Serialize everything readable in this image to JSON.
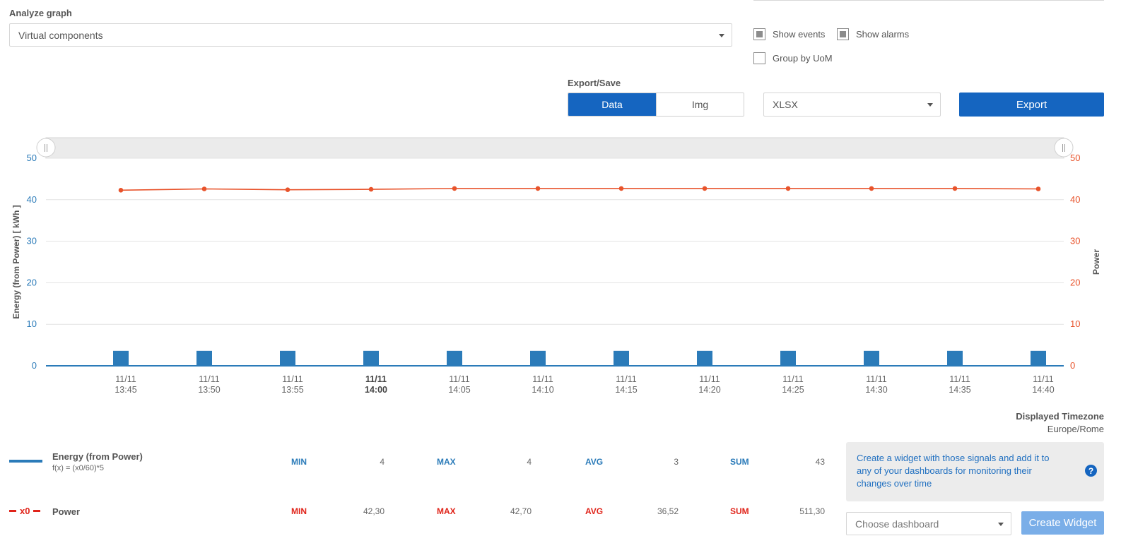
{
  "analyze": {
    "label": "Analyze graph",
    "selected": "Virtual components"
  },
  "options": {
    "show_events": {
      "label": "Show events",
      "checked": true
    },
    "show_alarms": {
      "label": "Show alarms",
      "checked": true
    },
    "group_uom": {
      "label": "Group by UoM",
      "checked": false
    }
  },
  "export": {
    "label": "Export/Save",
    "modes": [
      "Data",
      "Img"
    ],
    "active_mode": "Data",
    "format": "XLSX",
    "button": "Export"
  },
  "chart_data": {
    "type": "bar",
    "categories": [
      "11/11 13:45",
      "11/11 13:50",
      "11/11 13:55",
      "11/11 14:00",
      "11/11 14:05",
      "11/11 14:10",
      "11/11 14:15",
      "11/11 14:20",
      "11/11 14:25",
      "11/11 14:30",
      "11/11 14:35",
      "11/11 14:40"
    ],
    "tick_labels": [
      {
        "date": "11/11",
        "time": "13:45",
        "bold": false
      },
      {
        "date": "11/11",
        "time": "13:50",
        "bold": false
      },
      {
        "date": "11/11",
        "time": "13:55",
        "bold": false
      },
      {
        "date": "11/11",
        "time": "14:00",
        "bold": true
      },
      {
        "date": "11/11",
        "time": "14:05",
        "bold": false
      },
      {
        "date": "11/11",
        "time": "14:10",
        "bold": false
      },
      {
        "date": "11/11",
        "time": "14:15",
        "bold": false
      },
      {
        "date": "11/11",
        "time": "14:20",
        "bold": false
      },
      {
        "date": "11/11",
        "time": "14:25",
        "bold": false
      },
      {
        "date": "11/11",
        "time": "14:30",
        "bold": false
      },
      {
        "date": "11/11",
        "time": "14:35",
        "bold": false
      },
      {
        "date": "11/11",
        "time": "14:40",
        "bold": false
      }
    ],
    "series": [
      {
        "name": "Energy (from Power)",
        "kind": "bar",
        "axis": "left",
        "color": "#2b7bb9",
        "values": [
          3.6,
          3.6,
          3.6,
          3.6,
          3.6,
          3.6,
          3.6,
          3.6,
          3.6,
          3.6,
          3.6,
          3.6
        ]
      },
      {
        "name": "Power",
        "kind": "line",
        "axis": "right",
        "color": "#e8532b",
        "values": [
          42.3,
          42.6,
          42.4,
          42.5,
          42.7,
          42.7,
          42.7,
          42.7,
          42.7,
          42.7,
          42.7,
          42.6
        ]
      }
    ],
    "ylabel_left": "Energy (from Power) [ kWh ]",
    "ylabel_right": "Power",
    "ylim": [
      0,
      50
    ],
    "yticks": [
      "0",
      "10",
      "20",
      "30",
      "40",
      "50"
    ],
    "grid": true,
    "left_axis_color": "#2b7bb9",
    "right_axis_color": "#e8532b"
  },
  "timezone": {
    "label": "Displayed Timezone",
    "value": "Europe/Rome"
  },
  "legend": [
    {
      "name": "Energy (from Power)",
      "formula": "f(x) = (x0/60)*5",
      "color": "#2b7bb9",
      "prefix": "",
      "min_label": "MIN",
      "min": "4",
      "max_label": "MAX",
      "max": "4",
      "avg_label": "AVG",
      "avg": "3",
      "sum_label": "SUM",
      "sum": "43"
    },
    {
      "name": "Power",
      "formula": "",
      "color": "#e0241a",
      "prefix": "x0",
      "min_label": "MIN",
      "min": "42,30",
      "max_label": "MAX",
      "max": "42,70",
      "avg_label": "AVG",
      "avg": "36,52",
      "sum_label": "SUM",
      "sum": "511,30"
    }
  ],
  "widget": {
    "text": "Create a widget with those signals and add it to any of your dashboards for monitoring their changes over time",
    "help_icon": "?",
    "dashboard_placeholder": "Choose dashboard",
    "create_button": "Create Widget"
  }
}
